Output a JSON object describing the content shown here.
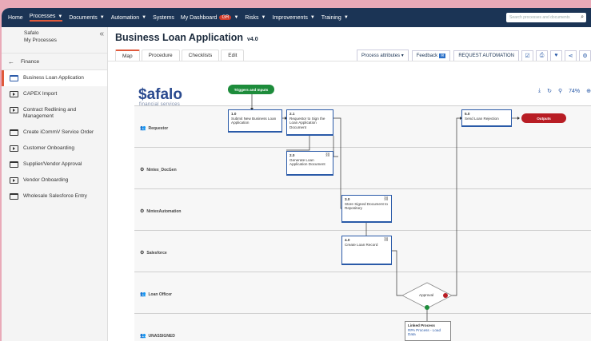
{
  "nav": {
    "items": [
      {
        "label": "Home",
        "caret": false,
        "active": false
      },
      {
        "label": "Processes",
        "caret": true,
        "active": true
      },
      {
        "label": "Documents",
        "caret": true,
        "active": false
      },
      {
        "label": "Automation",
        "caret": true,
        "active": false
      },
      {
        "label": "Systems",
        "caret": false,
        "active": false
      },
      {
        "label": "My Dashboard",
        "caret": true,
        "active": false,
        "badge": "GR"
      },
      {
        "label": "Risks",
        "caret": true,
        "active": false
      },
      {
        "label": "Improvements",
        "caret": true,
        "active": false
      },
      {
        "label": "Training",
        "caret": true,
        "active": false
      }
    ],
    "search_placeholder": "Search processes and documents"
  },
  "sidebar": {
    "org": "Safalo",
    "section": "My Processes",
    "back_label": "Finance",
    "items": [
      {
        "label": "Business Loan Application",
        "icon": "folder",
        "active": true
      },
      {
        "label": "CAPEX Import",
        "icon": "play",
        "active": false
      },
      {
        "label": "Contract Redlining and Management",
        "icon": "play",
        "active": false
      },
      {
        "label": "Create iCommV Service Order",
        "icon": "folder",
        "active": false
      },
      {
        "label": "Customer Onboarding",
        "icon": "play",
        "active": false
      },
      {
        "label": "Supplier/Vendor Approval",
        "icon": "folder",
        "active": false
      },
      {
        "label": "Vendor Onboarding",
        "icon": "play",
        "active": false
      },
      {
        "label": "Wholesale Salesforce Entry",
        "icon": "folder",
        "active": false
      }
    ]
  },
  "page": {
    "title": "Business Loan Application",
    "version": "v4.0",
    "tabs": [
      "Map",
      "Procedure",
      "Checklists",
      "Edit"
    ],
    "active_tab": "Map",
    "process_attributes_label": "Process attributes",
    "feedback_label": "Feedback",
    "request_automation_label": "REQUEST AUTOMATION"
  },
  "map": {
    "logo_text": "afalo",
    "logo_dollar": "$",
    "logo_sub": "financial services",
    "zoom_level": "74%",
    "triggers_label": "Triggers and Inputs",
    "outputs_label": "Outputs",
    "lanes": [
      {
        "name": "Requestor",
        "icon": "people-icon"
      },
      {
        "name": "Nintex_DocGen",
        "icon": "robot-icon"
      },
      {
        "name": "NintexAutomation",
        "icon": "robot-icon"
      },
      {
        "name": "Salesforce",
        "icon": "robot-icon"
      },
      {
        "name": "Loan Officer",
        "icon": "people-icon"
      },
      {
        "name": "UNASSIGNED",
        "icon": "people-icon"
      }
    ],
    "activities": [
      {
        "num": "1.0",
        "text": "Submit New Business Loan Application"
      },
      {
        "num": "2.1",
        "text": "Requestor to Sign the Loan Application Document"
      },
      {
        "num": "2.0",
        "text": "Generate Loan Application Document"
      },
      {
        "num": "3.0",
        "text": "Store Signed Document to Repository"
      },
      {
        "num": "4.0",
        "text": "Create Loan Record"
      },
      {
        "num": "5.0",
        "text": "Send Loan Rejection"
      }
    ],
    "decision_label": "Approval",
    "linked_process_title": "Linked Process",
    "linked_process_value": "RPA Process - Load Data"
  }
}
